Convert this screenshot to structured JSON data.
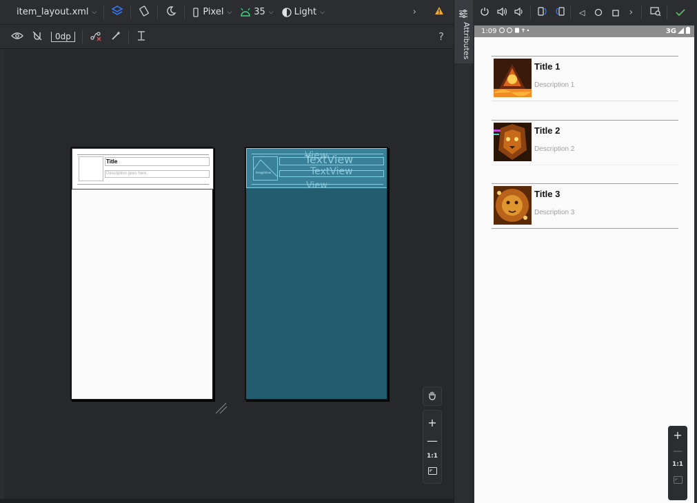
{
  "toolbar": {
    "file_name": "item_layout.xml",
    "device": "Pixel",
    "api_level": "35",
    "theme": "Light",
    "margin_value": "0dp",
    "help_label": "?"
  },
  "attributes_tab": {
    "label": "Attributes"
  },
  "design_preview": {
    "title_text": "Title",
    "description_text": "Description goes here."
  },
  "blueprint_preview": {
    "imageview_label": "ImageView",
    "textview_label_1": "TextView",
    "textview_label_2": "TextView",
    "view_label_1": "View",
    "view_label_2": "View"
  },
  "zoom_controls": {
    "one_to_one": "1:1"
  },
  "emulator": {
    "status_time": "1:09",
    "network": "3G",
    "items": [
      {
        "title": "Title 1",
        "description": "Description 1"
      },
      {
        "title": "Title 2",
        "description": "Description 2"
      },
      {
        "title": "Title 3",
        "description": "Description 3"
      }
    ],
    "zoom_one_to_one": "1:1"
  },
  "colors": {
    "ide_background": "#2b2d30",
    "canvas_background": "#27282c",
    "blueprint_blue": "#235c6e",
    "blueprint_line": "#7fd3e6",
    "accent_blue": "#3574f0",
    "warning_orange": "#f0a732",
    "success_green": "#5fb865",
    "android_green": "#3ddc84"
  }
}
